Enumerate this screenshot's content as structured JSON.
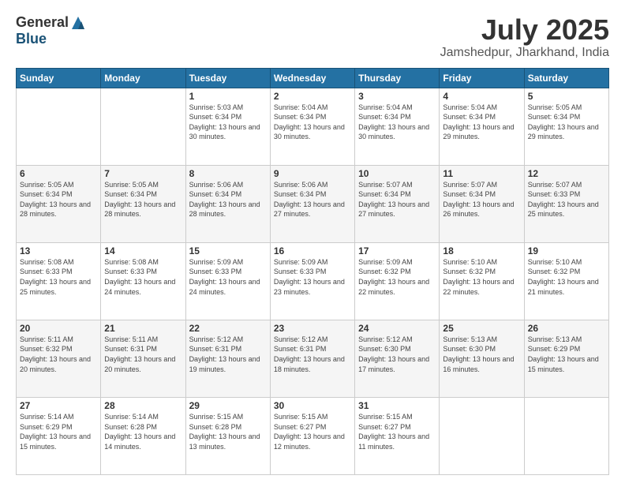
{
  "header": {
    "logo_general": "General",
    "logo_blue": "Blue",
    "title": "July 2025",
    "location": "Jamshedpur, Jharkhand, India"
  },
  "weekdays": [
    "Sunday",
    "Monday",
    "Tuesday",
    "Wednesday",
    "Thursday",
    "Friday",
    "Saturday"
  ],
  "weeks": [
    [
      {
        "day": "",
        "info": ""
      },
      {
        "day": "",
        "info": ""
      },
      {
        "day": "1",
        "info": "Sunrise: 5:03 AM\nSunset: 6:34 PM\nDaylight: 13 hours and 30 minutes."
      },
      {
        "day": "2",
        "info": "Sunrise: 5:04 AM\nSunset: 6:34 PM\nDaylight: 13 hours and 30 minutes."
      },
      {
        "day": "3",
        "info": "Sunrise: 5:04 AM\nSunset: 6:34 PM\nDaylight: 13 hours and 30 minutes."
      },
      {
        "day": "4",
        "info": "Sunrise: 5:04 AM\nSunset: 6:34 PM\nDaylight: 13 hours and 29 minutes."
      },
      {
        "day": "5",
        "info": "Sunrise: 5:05 AM\nSunset: 6:34 PM\nDaylight: 13 hours and 29 minutes."
      }
    ],
    [
      {
        "day": "6",
        "info": "Sunrise: 5:05 AM\nSunset: 6:34 PM\nDaylight: 13 hours and 28 minutes."
      },
      {
        "day": "7",
        "info": "Sunrise: 5:05 AM\nSunset: 6:34 PM\nDaylight: 13 hours and 28 minutes."
      },
      {
        "day": "8",
        "info": "Sunrise: 5:06 AM\nSunset: 6:34 PM\nDaylight: 13 hours and 28 minutes."
      },
      {
        "day": "9",
        "info": "Sunrise: 5:06 AM\nSunset: 6:34 PM\nDaylight: 13 hours and 27 minutes."
      },
      {
        "day": "10",
        "info": "Sunrise: 5:07 AM\nSunset: 6:34 PM\nDaylight: 13 hours and 27 minutes."
      },
      {
        "day": "11",
        "info": "Sunrise: 5:07 AM\nSunset: 6:34 PM\nDaylight: 13 hours and 26 minutes."
      },
      {
        "day": "12",
        "info": "Sunrise: 5:07 AM\nSunset: 6:33 PM\nDaylight: 13 hours and 25 minutes."
      }
    ],
    [
      {
        "day": "13",
        "info": "Sunrise: 5:08 AM\nSunset: 6:33 PM\nDaylight: 13 hours and 25 minutes."
      },
      {
        "day": "14",
        "info": "Sunrise: 5:08 AM\nSunset: 6:33 PM\nDaylight: 13 hours and 24 minutes."
      },
      {
        "day": "15",
        "info": "Sunrise: 5:09 AM\nSunset: 6:33 PM\nDaylight: 13 hours and 24 minutes."
      },
      {
        "day": "16",
        "info": "Sunrise: 5:09 AM\nSunset: 6:33 PM\nDaylight: 13 hours and 23 minutes."
      },
      {
        "day": "17",
        "info": "Sunrise: 5:09 AM\nSunset: 6:32 PM\nDaylight: 13 hours and 22 minutes."
      },
      {
        "day": "18",
        "info": "Sunrise: 5:10 AM\nSunset: 6:32 PM\nDaylight: 13 hours and 22 minutes."
      },
      {
        "day": "19",
        "info": "Sunrise: 5:10 AM\nSunset: 6:32 PM\nDaylight: 13 hours and 21 minutes."
      }
    ],
    [
      {
        "day": "20",
        "info": "Sunrise: 5:11 AM\nSunset: 6:32 PM\nDaylight: 13 hours and 20 minutes."
      },
      {
        "day": "21",
        "info": "Sunrise: 5:11 AM\nSunset: 6:31 PM\nDaylight: 13 hours and 20 minutes."
      },
      {
        "day": "22",
        "info": "Sunrise: 5:12 AM\nSunset: 6:31 PM\nDaylight: 13 hours and 19 minutes."
      },
      {
        "day": "23",
        "info": "Sunrise: 5:12 AM\nSunset: 6:31 PM\nDaylight: 13 hours and 18 minutes."
      },
      {
        "day": "24",
        "info": "Sunrise: 5:12 AM\nSunset: 6:30 PM\nDaylight: 13 hours and 17 minutes."
      },
      {
        "day": "25",
        "info": "Sunrise: 5:13 AM\nSunset: 6:30 PM\nDaylight: 13 hours and 16 minutes."
      },
      {
        "day": "26",
        "info": "Sunrise: 5:13 AM\nSunset: 6:29 PM\nDaylight: 13 hours and 15 minutes."
      }
    ],
    [
      {
        "day": "27",
        "info": "Sunrise: 5:14 AM\nSunset: 6:29 PM\nDaylight: 13 hours and 15 minutes."
      },
      {
        "day": "28",
        "info": "Sunrise: 5:14 AM\nSunset: 6:28 PM\nDaylight: 13 hours and 14 minutes."
      },
      {
        "day": "29",
        "info": "Sunrise: 5:15 AM\nSunset: 6:28 PM\nDaylight: 13 hours and 13 minutes."
      },
      {
        "day": "30",
        "info": "Sunrise: 5:15 AM\nSunset: 6:27 PM\nDaylight: 13 hours and 12 minutes."
      },
      {
        "day": "31",
        "info": "Sunrise: 5:15 AM\nSunset: 6:27 PM\nDaylight: 13 hours and 11 minutes."
      },
      {
        "day": "",
        "info": ""
      },
      {
        "day": "",
        "info": ""
      }
    ]
  ]
}
